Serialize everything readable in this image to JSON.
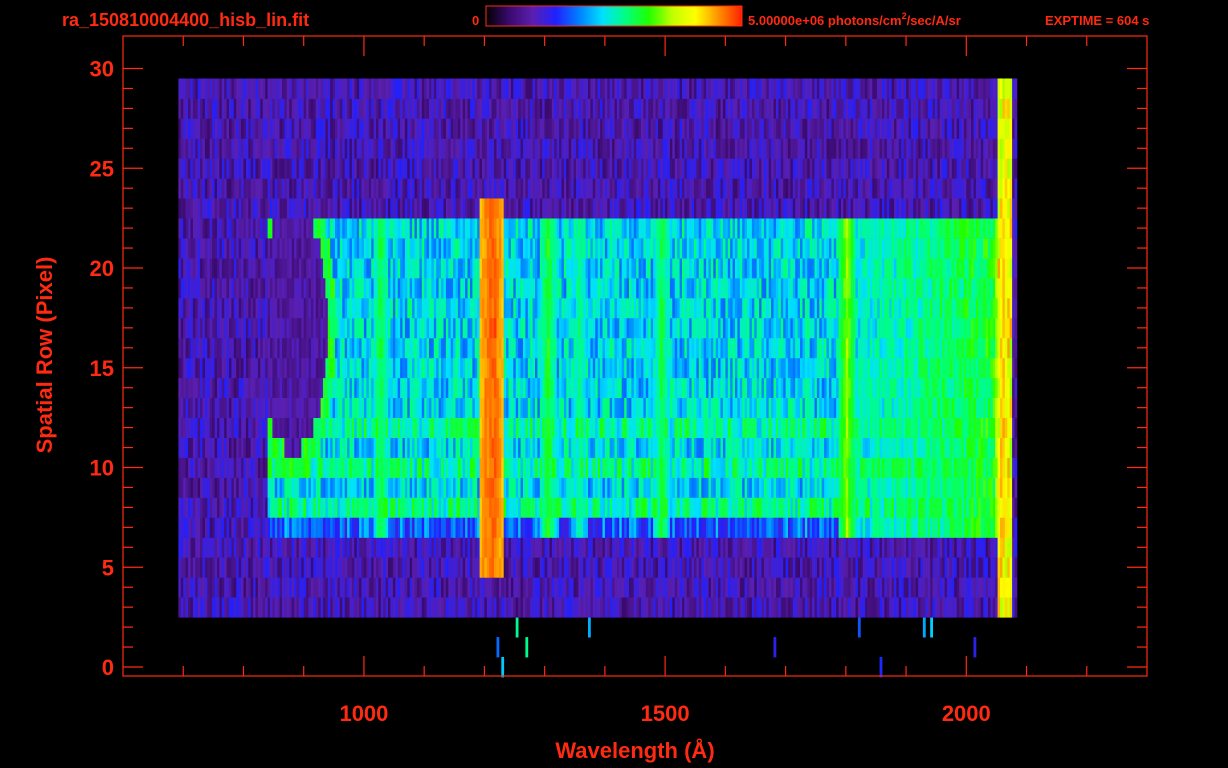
{
  "header": {
    "filename": "ra_150810004400_hisb_lin.fit",
    "colorbar_min_label": "0",
    "colorbar_max_value": "5.00000e+06",
    "units_prefix": "photons/cm",
    "units_exponent": "2",
    "units_suffix": "/sec/A/sr",
    "exptime": "EXPTIME = 604 s"
  },
  "colors": {
    "axis": "#ff2a12",
    "background": "#000000",
    "colormap": [
      "#000000",
      "#3a0a6e",
      "#5a1fb0",
      "#2020ff",
      "#0080ff",
      "#00e0ff",
      "#00ff80",
      "#20ff00",
      "#c0ff00",
      "#ffff00",
      "#ff9000",
      "#ff2000"
    ]
  },
  "chart_data": {
    "type": "heatmap",
    "title": "ra_150810004400_hisb_lin.fit",
    "xlabel": "Wavelength (Å)",
    "ylabel": "Spatial Row (Pixel)",
    "xlim": [
      600,
      2300
    ],
    "ylim": [
      0,
      30
    ],
    "x_ticks": [
      1000,
      1500,
      2000
    ],
    "y_ticks": [
      0,
      5,
      10,
      15,
      20,
      25,
      30
    ],
    "colorbar_range": [
      0,
      5000000
    ],
    "colorbar_units": "photons/cm^2/sec/A/sr",
    "colorscale": "rainbow",
    "regions": [
      {
        "feature": "detector_background",
        "x": [
          690,
          2080
        ],
        "rows": [
          3,
          30
        ],
        "level": 0.18
      },
      {
        "feature": "illuminated_slit",
        "x": [
          840,
          2070
        ],
        "rows": [
          7,
          23
        ],
        "level": 0.45
      },
      {
        "feature": "lyman_alpha",
        "x": [
          1190,
          1230
        ],
        "rows": [
          5,
          24
        ],
        "level": 0.95
      },
      {
        "feature": "long_wavelength_edge",
        "x": [
          1790,
          2070
        ],
        "rows": [
          7,
          23
        ],
        "level": 0.62
      },
      {
        "feature": "slit_hole_loop",
        "x": [
          820,
          940
        ],
        "rows": [
          11,
          23
        ],
        "level": 0.6
      }
    ],
    "emission_lines": [
      {
        "x": 1026,
        "level": 0.6
      },
      {
        "x": 1216,
        "level": 0.95
      },
      {
        "x": 1304,
        "level": 0.62
      },
      {
        "x": 1356,
        "level": 0.55
      },
      {
        "x": 1493,
        "level": 0.6
      },
      {
        "x": 1800,
        "level": 0.7
      },
      {
        "x": 2060,
        "level": 0.85
      }
    ]
  }
}
